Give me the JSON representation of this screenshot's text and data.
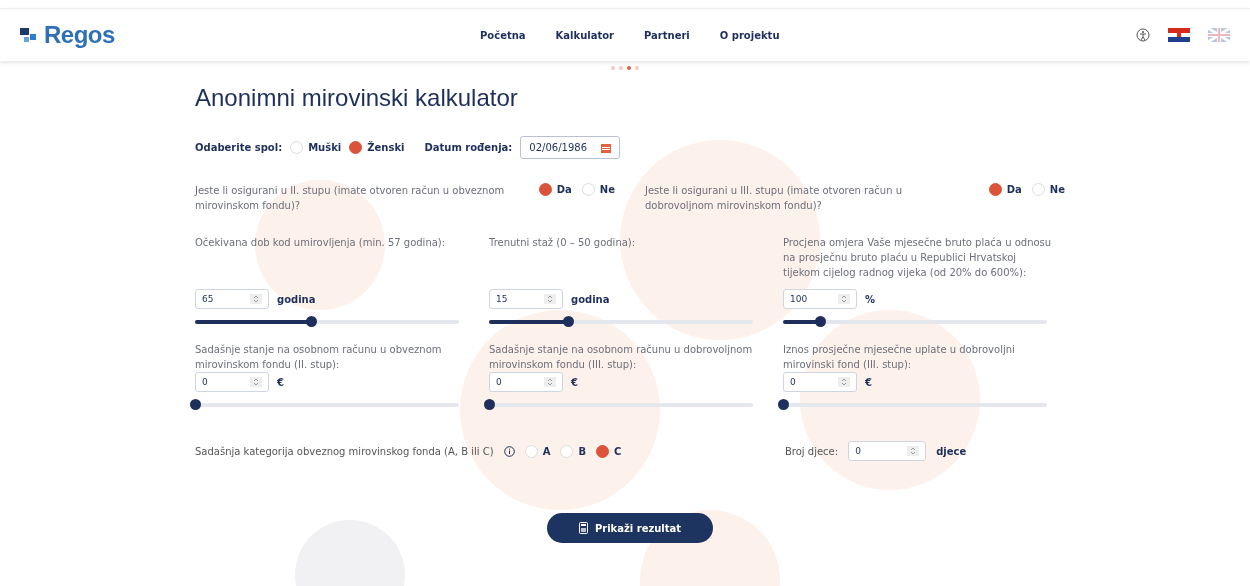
{
  "header": {
    "logo": "Regos",
    "nav": [
      {
        "label": "Početna"
      },
      {
        "label": "Kalkulator"
      },
      {
        "label": "Partneri"
      },
      {
        "label": "O projektu"
      }
    ],
    "languages": [
      {
        "kind": "hr",
        "selected": true
      },
      {
        "kind": "en",
        "selected": false
      }
    ]
  },
  "pager": [
    {
      "selected": false
    },
    {
      "selected": false
    },
    {
      "selected": true
    },
    {
      "selected": false
    }
  ],
  "title": "Anonimni mirovinski kalkulator",
  "gender": {
    "label": "Odaberite spol:",
    "options": [
      {
        "label": "Muški",
        "selected": false
      },
      {
        "label": "Ženski",
        "selected": true
      }
    ]
  },
  "birth_date": {
    "label": "Datum rođenja:",
    "value": "02/06/1986"
  },
  "questions": [
    {
      "label": "Jeste li osigurani u II. stupu (imate otvoren račun u obveznom mirovinskom fondu)?",
      "options": [
        {
          "label": "Da",
          "selected": true
        },
        {
          "label": "Ne",
          "selected": false
        }
      ]
    },
    {
      "label": "Jeste li osigurani u III. stupu (imate otvoren račun u dobrovoljnom mirovinskom fondu)?",
      "options": [
        {
          "label": "Da",
          "selected": true
        },
        {
          "label": "Ne",
          "selected": false
        }
      ]
    }
  ],
  "sliders": [
    {
      "label": "Očekivana dob kod umirovljenja (min. 57 godina):",
      "value": "65",
      "unit": "godina",
      "level": 0.44
    },
    {
      "label": "Trenutni staž (0 – 50 godina):",
      "value": "15",
      "unit": "godina",
      "level": 0.3
    },
    {
      "label": "Procjena omjera Vaše mjesečne bruto plaća u odnosu na prosječnu bruto plaću u Republici Hrvatskoj tijekom cijelog radnog vijeka (od 20% do 600%):",
      "value": "100",
      "unit": "%",
      "level": 0.14
    },
    {
      "label": "Sadašnje stanje na osobnom računu u obveznom mirovinskom fondu (II. stup):",
      "value": "0",
      "unit": "€",
      "level": 0
    },
    {
      "label": "Sadašnje stanje na osobnom računu u dobrovoljnom mirovinskom fondu (III. stup):",
      "value": "0",
      "unit": "€",
      "level": 0
    },
    {
      "label": "Iznos prosječne mjesečne uplate u dobrovoljni mirovinski fond (III. stup):",
      "value": "0",
      "unit": "€",
      "level": 0
    }
  ],
  "category": {
    "label": "Sadašnja kategorija obveznog mirovinskog fonda (A, B ili C)",
    "options": [
      {
        "label": "A",
        "selected": false
      },
      {
        "label": "B",
        "selected": false
      },
      {
        "label": "C",
        "selected": true
      }
    ]
  },
  "children": {
    "label": "Broj djece:",
    "value": "0",
    "unit": "djece"
  },
  "submit": "Prikaži rezultat"
}
